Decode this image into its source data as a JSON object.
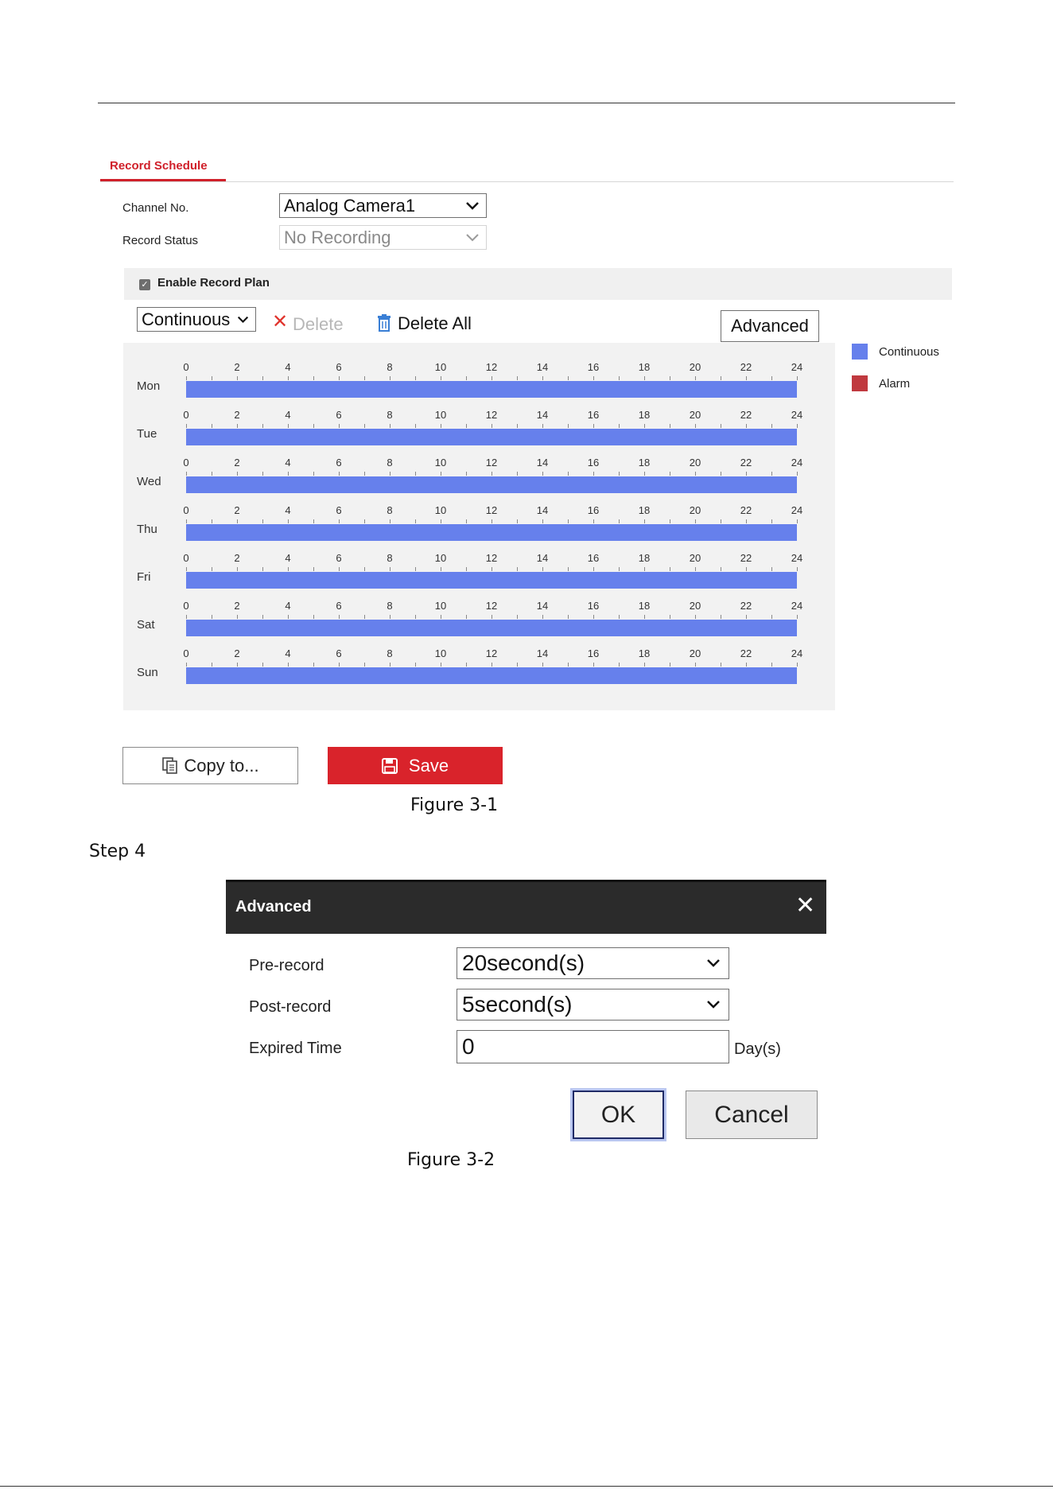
{
  "figure1": {
    "tab_label": "Record Schedule",
    "channel_no": {
      "label": "Channel No.",
      "value": "Analog Camera1"
    },
    "record_status": {
      "label": "Record Status",
      "value": "No Recording"
    },
    "enable_record_plan": {
      "label": "Enable Record Plan",
      "checked": true
    },
    "toolbar": {
      "mode_select": "Continuous",
      "delete_label": "Delete",
      "delete_all_label": "Delete All",
      "advanced_label": "Advanced"
    },
    "hour_ticks": [
      "0",
      "2",
      "4",
      "6",
      "8",
      "10",
      "12",
      "14",
      "16",
      "18",
      "20",
      "22",
      "24"
    ],
    "days": [
      {
        "label": "Mon",
        "start": 0,
        "end": 24,
        "type": "Continuous"
      },
      {
        "label": "Tue",
        "start": 0,
        "end": 24,
        "type": "Continuous"
      },
      {
        "label": "Wed",
        "start": 0,
        "end": 24,
        "type": "Continuous"
      },
      {
        "label": "Thu",
        "start": 0,
        "end": 24,
        "type": "Continuous"
      },
      {
        "label": "Fri",
        "start": 0,
        "end": 24,
        "type": "Continuous"
      },
      {
        "label": "Sat",
        "start": 0,
        "end": 24,
        "type": "Continuous"
      },
      {
        "label": "Sun",
        "start": 0,
        "end": 24,
        "type": "Continuous"
      }
    ],
    "legend": [
      {
        "label": "Continuous",
        "color": "#6680ec"
      },
      {
        "label": "Alarm",
        "color": "#c0393f"
      }
    ],
    "copy_label": "Copy to...",
    "save_label": "Save",
    "caption": "Figure 3-1"
  },
  "step_label": "Step 4",
  "figure2": {
    "title": "Advanced",
    "pre_record": {
      "label": "Pre-record",
      "value": "20second(s)"
    },
    "post_record": {
      "label": "Post-record",
      "value": "5second(s)"
    },
    "expired_time": {
      "label": "Expired Time",
      "value": "0",
      "unit": "Day(s)"
    },
    "ok_label": "OK",
    "cancel_label": "Cancel",
    "caption": "Figure 3-2"
  },
  "colors": {
    "accent": "#d9232b",
    "bar": "#6680ec",
    "dialog_header": "#2b2b2b"
  }
}
